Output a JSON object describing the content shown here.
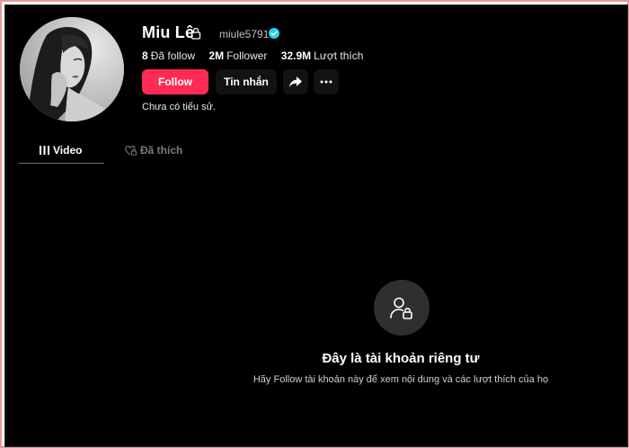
{
  "profile": {
    "name": "Miu Lê",
    "username": "miule5791",
    "bio": "Chưa có tiểu sử.",
    "stats": [
      {
        "value": "8",
        "label": "Đã follow"
      },
      {
        "value": "2M",
        "label": "Follower"
      },
      {
        "value": "32.9M",
        "label": "Lượt thích"
      }
    ]
  },
  "actions": {
    "follow_label": "Follow",
    "message_label": "Tin nhắn",
    "share_icon": "share-icon",
    "more_icon": "more-icon"
  },
  "tabs": [
    {
      "label": "Video",
      "icon": "grid-icon",
      "active": true
    },
    {
      "label": "Đã thích",
      "icon": "heart-lock-icon",
      "active": false
    }
  ],
  "private_notice": {
    "title": "Đây là tài khoản riêng tư",
    "description": "Hãy Follow tài khoản này để xem nội dung và các lượt thích của họ",
    "icon": "user-lock-icon"
  },
  "colors": {
    "background": "#000000",
    "accent": "#fe2c55",
    "verified": "#20d5ec"
  }
}
